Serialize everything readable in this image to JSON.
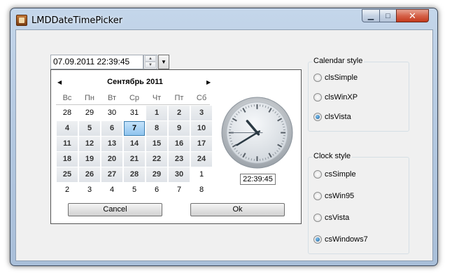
{
  "window": {
    "title": "LMDDateTimePicker",
    "minimize_glyph": "▁",
    "maximize_glyph": "□",
    "close_glyph": "✕"
  },
  "picker": {
    "value": "07.09.2011 22:39:45",
    "spin_up_icon": "▲",
    "spin_down_icon": "▼",
    "dropdown_icon": "▼"
  },
  "calendar": {
    "prev_icon": "◀",
    "next_icon": "▶",
    "month_title": "Сентябрь 2011",
    "weekdays": [
      "Вс",
      "Пн",
      "Вт",
      "Ср",
      "Чт",
      "Пт",
      "Сб"
    ],
    "weeks": [
      [
        {
          "d": "28",
          "c": false
        },
        {
          "d": "29",
          "c": false
        },
        {
          "d": "30",
          "c": false
        },
        {
          "d": "31",
          "c": false
        },
        {
          "d": "1",
          "c": true
        },
        {
          "d": "2",
          "c": true
        },
        {
          "d": "3",
          "c": true
        }
      ],
      [
        {
          "d": "4",
          "c": true
        },
        {
          "d": "5",
          "c": true
        },
        {
          "d": "6",
          "c": true
        },
        {
          "d": "7",
          "c": true,
          "sel": true
        },
        {
          "d": "8",
          "c": true
        },
        {
          "d": "9",
          "c": true
        },
        {
          "d": "10",
          "c": true
        }
      ],
      [
        {
          "d": "11",
          "c": true
        },
        {
          "d": "12",
          "c": true
        },
        {
          "d": "13",
          "c": true
        },
        {
          "d": "14",
          "c": true
        },
        {
          "d": "15",
          "c": true
        },
        {
          "d": "16",
          "c": true
        },
        {
          "d": "17",
          "c": true
        }
      ],
      [
        {
          "d": "18",
          "c": true
        },
        {
          "d": "19",
          "c": true
        },
        {
          "d": "20",
          "c": true
        },
        {
          "d": "21",
          "c": true
        },
        {
          "d": "22",
          "c": true
        },
        {
          "d": "23",
          "c": true
        },
        {
          "d": "24",
          "c": true
        }
      ],
      [
        {
          "d": "25",
          "c": true
        },
        {
          "d": "26",
          "c": true
        },
        {
          "d": "27",
          "c": true
        },
        {
          "d": "28",
          "c": true
        },
        {
          "d": "29",
          "c": true
        },
        {
          "d": "30",
          "c": true
        },
        {
          "d": "1",
          "c": false
        }
      ],
      [
        {
          "d": "2",
          "c": false
        },
        {
          "d": "3",
          "c": false
        },
        {
          "d": "4",
          "c": false
        },
        {
          "d": "5",
          "c": false
        },
        {
          "d": "6",
          "c": false
        },
        {
          "d": "7",
          "c": false
        },
        {
          "d": "8",
          "c": false
        }
      ]
    ],
    "time": "22:39:45",
    "cancel_label": "Cancel",
    "ok_label": "Ok",
    "clock_hour": 22,
    "clock_minute": 39,
    "clock_second": 45
  },
  "calendar_style": {
    "title": "Calendar style",
    "options": [
      {
        "label": "clsSimple",
        "checked": false
      },
      {
        "label": "clsWinXP",
        "checked": false
      },
      {
        "label": "clsVista",
        "checked": true
      }
    ]
  },
  "clock_style": {
    "title": "Clock style",
    "options": [
      {
        "label": "csSimple",
        "checked": false
      },
      {
        "label": "csWin95",
        "checked": false
      },
      {
        "label": "csVista",
        "checked": false
      },
      {
        "label": "csWindows7",
        "checked": true
      }
    ]
  },
  "colors": {
    "selected_day": "#8fc4ee",
    "radio_checked": "#1b5e97"
  }
}
